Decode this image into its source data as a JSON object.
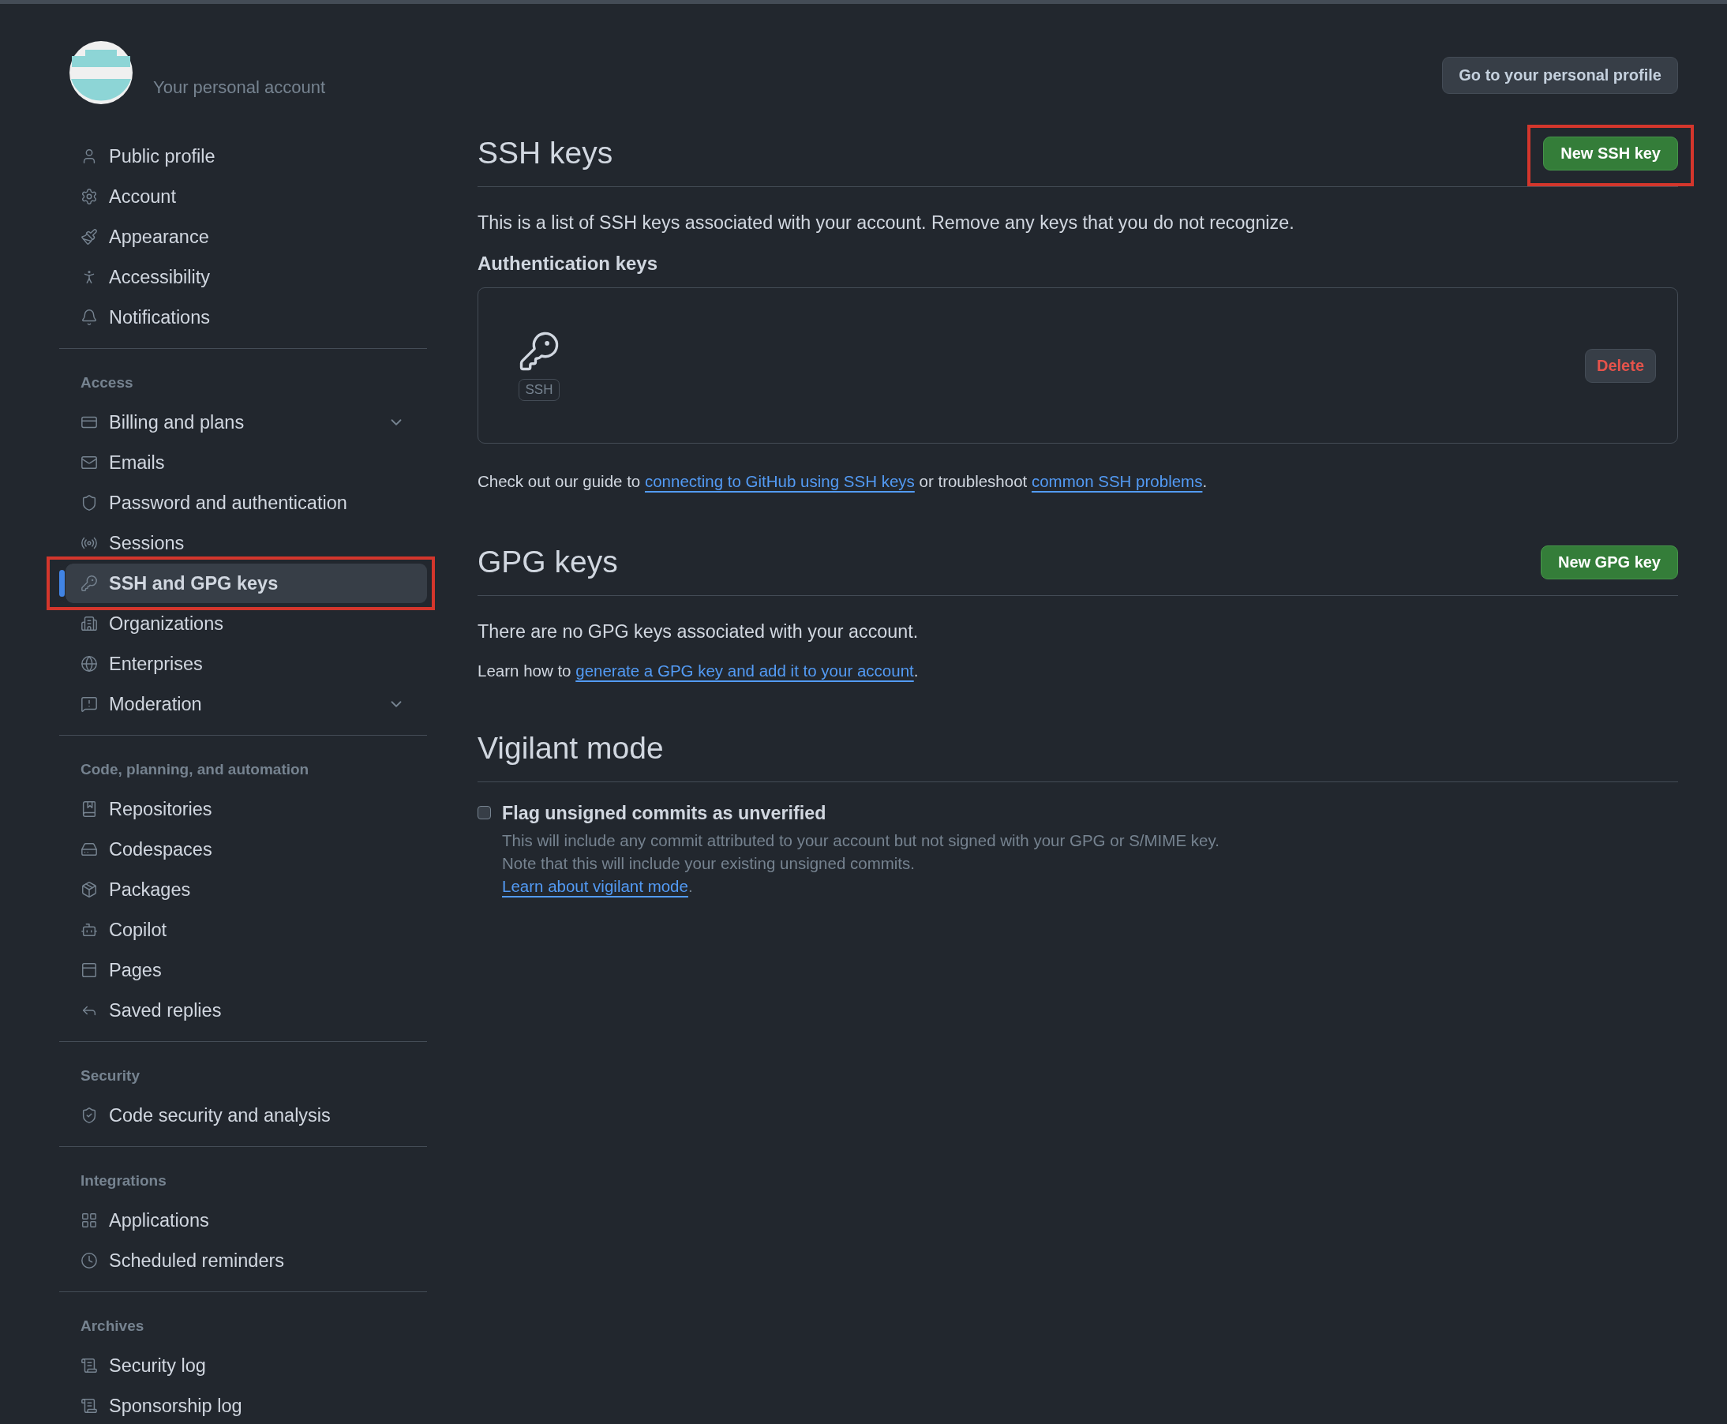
{
  "account": {
    "label": "Your personal account",
    "profile_button": "Go to your personal profile"
  },
  "sidebar": {
    "sections": [
      {
        "items": [
          {
            "label": "Public profile",
            "selected": false
          },
          {
            "label": "Account",
            "selected": false
          },
          {
            "label": "Appearance",
            "selected": false
          },
          {
            "label": "Accessibility",
            "selected": false
          },
          {
            "label": "Notifications",
            "selected": false
          }
        ]
      },
      {
        "heading": "Access",
        "items": [
          {
            "label": "Billing and plans",
            "selected": false,
            "expandable": true
          },
          {
            "label": "Emails",
            "selected": false
          },
          {
            "label": "Password and authentication",
            "selected": false
          },
          {
            "label": "Sessions",
            "selected": false
          },
          {
            "label": "SSH and GPG keys",
            "selected": true,
            "highlighted": true
          },
          {
            "label": "Organizations",
            "selected": false
          },
          {
            "label": "Enterprises",
            "selected": false
          },
          {
            "label": "Moderation",
            "selected": false,
            "expandable": true
          }
        ]
      },
      {
        "heading": "Code, planning, and automation",
        "items": [
          {
            "label": "Repositories",
            "selected": false
          },
          {
            "label": "Codespaces",
            "selected": false
          },
          {
            "label": "Packages",
            "selected": false
          },
          {
            "label": "Copilot",
            "selected": false
          },
          {
            "label": "Pages",
            "selected": false
          },
          {
            "label": "Saved replies",
            "selected": false
          }
        ]
      },
      {
        "heading": "Security",
        "items": [
          {
            "label": "Code security and analysis",
            "selected": false
          }
        ]
      },
      {
        "heading": "Integrations",
        "items": [
          {
            "label": "Applications",
            "selected": false
          },
          {
            "label": "Scheduled reminders",
            "selected": false
          }
        ]
      },
      {
        "heading": "Archives",
        "items": [
          {
            "label": "Security log",
            "selected": false
          },
          {
            "label": "Sponsorship log",
            "selected": false
          }
        ]
      }
    ]
  },
  "ssh": {
    "title": "SSH keys",
    "button": {
      "label": "New SSH key",
      "highlighted": true
    },
    "description": "This is a list of SSH keys associated with your account. Remove any keys that you do not recognize.",
    "subtitle": "Authentication keys",
    "keys": [
      {
        "badge": "SSH",
        "delete_label": "Delete"
      }
    ],
    "guide": [
      {
        "kind": "text",
        "text": "Check out our guide to "
      },
      {
        "kind": "link",
        "text": "connecting to GitHub using SSH keys"
      },
      {
        "kind": "text",
        "text": " or troubleshoot "
      },
      {
        "kind": "link",
        "text": "common SSH problems"
      },
      {
        "kind": "text",
        "text": "."
      }
    ]
  },
  "gpg": {
    "title": "GPG keys",
    "button": {
      "label": "New GPG key",
      "highlighted": false
    },
    "empty": "There are no GPG keys associated with your account.",
    "learn": [
      {
        "kind": "text",
        "text": "Learn how to "
      },
      {
        "kind": "link",
        "text": "generate a GPG key and add it to your account"
      },
      {
        "kind": "text",
        "text": "."
      }
    ]
  },
  "vigilant": {
    "title": "Vigilant mode",
    "option": {
      "label": "Flag unsigned commits as unverified",
      "checked": false,
      "note_1": "This will include any commit attributed to your account but not signed with your GPG or S/MIME key.",
      "note_2": "Note that this will include your existing unsigned commits.",
      "learn": [
        {
          "kind": "link",
          "text": "Learn about vigilant mode"
        },
        {
          "kind": "text",
          "text": "."
        }
      ]
    }
  }
}
